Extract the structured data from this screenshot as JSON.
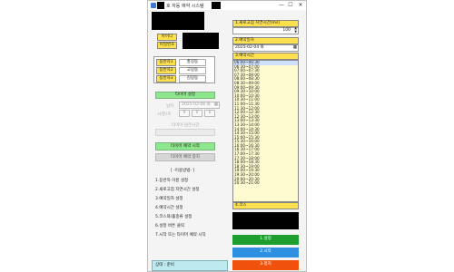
{
  "window": {
    "title": "호 자동 예약 시스템",
    "minimize": "—",
    "maximize": "☐",
    "close": "✕"
  },
  "login": {
    "id_label": "아이디",
    "pw_label": "비밀번호"
  },
  "companions": [
    {
      "label": "동반자1",
      "name": "홍길동"
    },
    {
      "label": "동반자2",
      "name": "고길동"
    },
    {
      "label": "동반자3",
      "name": "김길동"
    }
  ],
  "timer": {
    "setting_button": "타이머 설정",
    "date_label": "날자",
    "date_value": "2025-02-08 화",
    "time_label": "시/분/초",
    "hour": "9",
    "minute": "0",
    "second": "0",
    "remaining_label": "타이머 남은시간",
    "start_button": "타이머 예약 시작",
    "stop_button": "타이머 예약 중지"
  },
  "instructions": {
    "heading": "[ -이용방법- ]",
    "steps": [
      "1.동반자 이름 설정",
      "2.새로고침 지연시간 설정",
      "3.예약일자 설정",
      "4.예약시간 설정",
      "5.코스와/홀종류 설정",
      "6.설정 버튼 클릭",
      "7.시작 또는 타이머 예약 시작"
    ]
  },
  "status": {
    "text": "상태 : 준비"
  },
  "right": {
    "refresh_label": "1.새로고침 지연시간(ms)",
    "refresh_value": "100",
    "date_label": "2.예약일자",
    "date_value": "2025-02-04 화",
    "time_label": "3.예약시간",
    "time_slots": [
      "06:00~06:30",
      "06:30~07:00",
      "07:00~07:30",
      "07:30~08:00",
      "08:00~08:30",
      "08:30~09:00",
      "09:00~09:30",
      "09:30~10:00",
      "10:00~10:30",
      "10:30~11:00",
      "11:00~11:30",
      "11:30~12:00",
      "12:00~12:30",
      "12:30~13:00",
      "13:00~13:30",
      "13:30~14:00",
      "14:00~14:30",
      "14:30~15:00",
      "15:00~15:30",
      "15:30~16:00",
      "16:00~16:30",
      "16:30~17:00",
      "17:00~17:30",
      "17:30~18:00",
      "18:00~18:30",
      "18:30~19:00",
      "19:00~19:30",
      "19:30~20:00",
      "20:00~20:30",
      "20:30~21:00"
    ],
    "selected_slot": "06:00~06:30",
    "course_label": "4.코스",
    "setting_button": "1.설정",
    "start_button": "2.시작",
    "stop_button": "3.정지"
  },
  "colors": {
    "setting": "#1e9e2e",
    "start": "#2f8fe0",
    "stop": "#f0520e",
    "label_yellow": "#ffe14d"
  }
}
